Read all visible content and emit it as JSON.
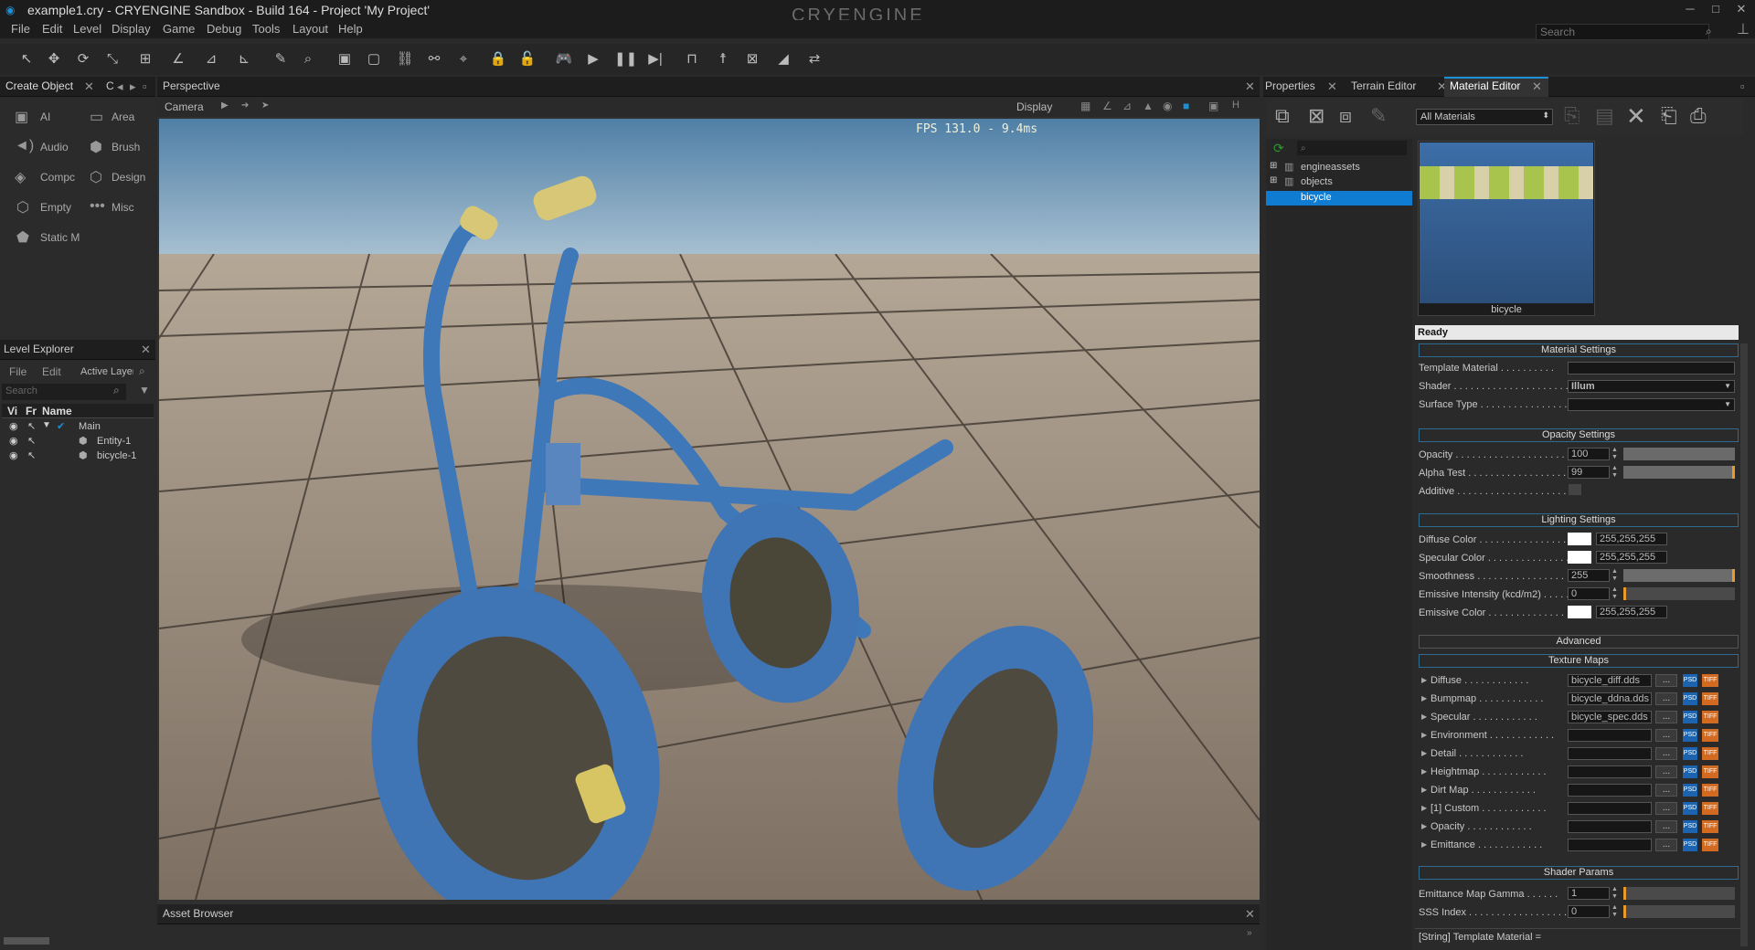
{
  "window": {
    "title": "example1.cry - CRYENGINE Sandbox - Build 164 - Project 'My Project'",
    "logo": "CRYENGINE",
    "min": "─",
    "max": "□",
    "close": "✕"
  },
  "menu": [
    "File",
    "Edit",
    "Level",
    "Display",
    "Game",
    "Debug",
    "Tools",
    "Layout",
    "Help"
  ],
  "search": {
    "placeholder": "Search"
  },
  "create_object": {
    "tab": "Create Object",
    "tab2": "C",
    "items": [
      "AI",
      "Area",
      "Audio",
      "Brush",
      "Compc",
      "Design",
      "Empty",
      "Misc",
      "Static M"
    ]
  },
  "level_explorer": {
    "title": "Level Explorer",
    "menu": [
      "File",
      "Edit",
      "Active Layer"
    ],
    "search": "Search",
    "columns": [
      "Vi",
      "Fr",
      "Name"
    ],
    "rows": [
      "Main",
      "Entity-1",
      "bicycle-1"
    ]
  },
  "viewport": {
    "title": "Perspective",
    "camera": "Camera",
    "display": "Display",
    "fps": "FPS 131.0 - 9.4ms",
    "tool_h": "H"
  },
  "asset_browser": {
    "title": "Asset Browser"
  },
  "right_tabs": [
    "Properties",
    "Terrain Editor",
    "Material Editor"
  ],
  "material_editor": {
    "filter": "All Materials",
    "tree": [
      "engineassets",
      "objects",
      "bicycle"
    ],
    "preview_label": "bicycle",
    "status": "Ready",
    "sections": {
      "material": "Material Settings",
      "opacity": "Opacity Settings",
      "lighting": "Lighting Settings",
      "advanced": "Advanced",
      "texture": "Texture Maps",
      "shader": "Shader Params"
    },
    "material_settings": [
      {
        "label": "Template Material",
        "value": ""
      },
      {
        "label": "Shader",
        "value": "Illum"
      },
      {
        "label": "Surface Type",
        "value": ""
      }
    ],
    "opacity_settings": [
      {
        "label": "Opacity",
        "value": "100"
      },
      {
        "label": "Alpha Test",
        "value": "99"
      },
      {
        "label": "Additive",
        "value": ""
      }
    ],
    "lighting_settings": [
      {
        "label": "Diffuse Color",
        "value": "255,255,255"
      },
      {
        "label": "Specular Color",
        "value": "255,255,255"
      },
      {
        "label": "Smoothness",
        "value": "255"
      },
      {
        "label": "Emissive Intensity (kcd/m2)",
        "value": "0"
      },
      {
        "label": "Emissive Color",
        "value": "255,255,255"
      }
    ],
    "texture_maps": [
      {
        "label": "Diffuse",
        "value": "bicycle_diff.dds"
      },
      {
        "label": "Bumpmap",
        "value": "bicycle_ddna.dds"
      },
      {
        "label": "Specular",
        "value": "bicycle_spec.dds"
      },
      {
        "label": "Environment",
        "value": ""
      },
      {
        "label": "Detail",
        "value": ""
      },
      {
        "label": "Heightmap",
        "value": ""
      },
      {
        "label": "Dirt Map",
        "value": ""
      },
      {
        "label": "[1] Custom",
        "value": ""
      },
      {
        "label": "Opacity",
        "value": ""
      },
      {
        "label": "Emittance",
        "value": ""
      }
    ],
    "shader_params": [
      {
        "label": "Emittance Map Gamma",
        "value": "1"
      },
      {
        "label": "SSS Index",
        "value": "0"
      }
    ],
    "footer": "[String] Template Material =",
    "browse": "...",
    "psd": "PSD",
    "tif": "TIFF"
  },
  "colors": {
    "accent": "#1c8fd6",
    "selection": "#0f7cd2"
  }
}
